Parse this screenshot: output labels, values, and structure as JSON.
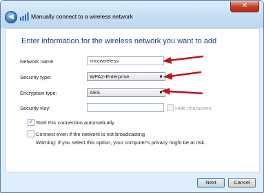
{
  "window": {
    "title": "Manually connect to a wireless network",
    "close_glyph": "✕"
  },
  "dialog": {
    "heading": "Enter information for the wireless network you want to add",
    "fields": {
      "network_name": {
        "label": "Network name:",
        "value": "mccwireless"
      },
      "security_type": {
        "label": "Security type:",
        "value": "WPA2-Enterprise"
      },
      "encryption_type": {
        "label": "Encryption type:",
        "value": "AES"
      },
      "security_key": {
        "label": "Security Key:",
        "value": ""
      }
    },
    "hide_characters": {
      "label": "Hide characters",
      "checked": false,
      "enabled": false
    },
    "start_automatically": {
      "label": "Start this connection automatically",
      "checked": true
    },
    "connect_not_broadcasting": {
      "label": "Connect even if the network is not broadcasting",
      "checked": false
    },
    "warning": "Warning: If you select this option, your computer's privacy might be at risk."
  },
  "buttons": {
    "next": "Next",
    "cancel": "Cancel"
  },
  "icons": {
    "back": "back-arrow-icon",
    "wifi": "wireless-network-icon",
    "dropdown": "chevron-down-icon",
    "annotation": "red-arrow"
  },
  "colors": {
    "heading": "#1e3f8f",
    "annotation_arrow": "#c0101a",
    "close_button": "#c8412b"
  }
}
